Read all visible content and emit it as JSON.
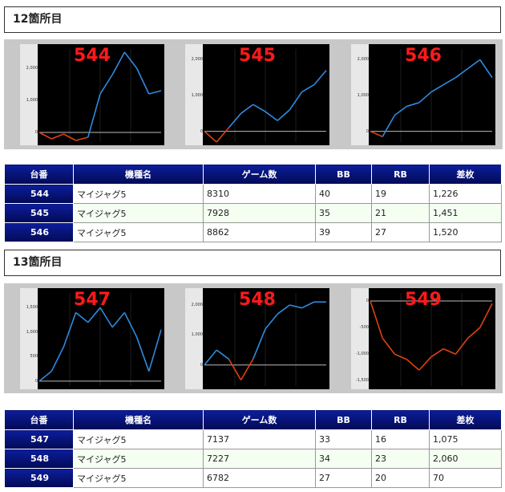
{
  "sections": [
    {
      "title": "12箇所目",
      "charts": [
        {
          "number": "544",
          "ticks": [
            "2,000",
            "1,000",
            "0"
          ]
        },
        {
          "number": "545",
          "ticks": [
            "2,000",
            "1,000",
            "0"
          ]
        },
        {
          "number": "546",
          "ticks": [
            "2,000",
            "1,000",
            "0"
          ]
        }
      ],
      "table": {
        "headers": [
          "台番",
          "機種名",
          "ゲーム数",
          "BB",
          "RB",
          "差枚"
        ],
        "rows": [
          [
            "544",
            "マイジャグ5",
            "8310",
            "40",
            "19",
            "1,226"
          ],
          [
            "545",
            "マイジャグ5",
            "7928",
            "35",
            "21",
            "1,451"
          ],
          [
            "546",
            "マイジャグ5",
            "8862",
            "39",
            "27",
            "1,520"
          ]
        ]
      }
    },
    {
      "title": "13箇所目",
      "charts": [
        {
          "number": "547",
          "ticks": [
            "1,500",
            "1,000",
            "500",
            "0"
          ]
        },
        {
          "number": "548",
          "ticks": [
            "2,000",
            "1,000",
            "0"
          ]
        },
        {
          "number": "549",
          "ticks": [
            "0",
            "-500",
            "-1,000",
            "-1,500"
          ]
        }
      ],
      "table": {
        "headers": [
          "台番",
          "機種名",
          "ゲーム数",
          "BB",
          "RB",
          "差枚"
        ],
        "rows": [
          [
            "547",
            "マイジャグ5",
            "7137",
            "33",
            "16",
            "1,075"
          ],
          [
            "548",
            "マイジャグ5",
            "7227",
            "34",
            "23",
            "2,060"
          ],
          [
            "549",
            "マイジャグ5",
            "6782",
            "27",
            "20",
            "70"
          ]
        ]
      }
    }
  ],
  "chart_data": [
    {
      "type": "line",
      "ylim": [
        -300,
        2600
      ],
      "x": [
        0,
        10,
        20,
        30,
        40,
        50,
        60,
        70,
        80,
        90,
        100
      ],
      "values": [
        0,
        -200,
        -50,
        -250,
        -150,
        1200,
        1800,
        2500,
        2000,
        1200,
        1300
      ]
    },
    {
      "type": "line",
      "ylim": [
        -300,
        2300
      ],
      "x": [
        0,
        10,
        20,
        30,
        40,
        50,
        60,
        70,
        80,
        90,
        100
      ],
      "values": [
        0,
        -300,
        100,
        500,
        750,
        550,
        300,
        600,
        1100,
        1300,
        1700
      ]
    },
    {
      "type": "line",
      "ylim": [
        -300,
        2300
      ],
      "x": [
        0,
        10,
        20,
        30,
        40,
        50,
        60,
        70,
        80,
        90,
        100
      ],
      "values": [
        0,
        -150,
        450,
        700,
        800,
        1100,
        1300,
        1500,
        1750,
        2000,
        1500
      ]
    },
    {
      "type": "line",
      "ylim": [
        -100,
        1800
      ],
      "x": [
        0,
        10,
        20,
        30,
        40,
        50,
        60,
        70,
        80,
        90,
        100
      ],
      "values": [
        0,
        200,
        700,
        1400,
        1200,
        1500,
        1100,
        1400,
        900,
        200,
        1050
      ]
    },
    {
      "type": "line",
      "ylim": [
        -700,
        2400
      ],
      "x": [
        0,
        10,
        20,
        30,
        40,
        50,
        60,
        70,
        80,
        90,
        100
      ],
      "values": [
        0,
        500,
        200,
        -500,
        200,
        1200,
        1700,
        2000,
        1900,
        2100,
        2100
      ]
    },
    {
      "type": "line",
      "ylim": [
        -1600,
        150
      ],
      "x": [
        0,
        10,
        20,
        30,
        40,
        50,
        60,
        70,
        80,
        90,
        100
      ],
      "values": [
        0,
        -700,
        -1000,
        -1100,
        -1300,
        -1050,
        -900,
        -1000,
        -700,
        -500,
        -50
      ]
    }
  ],
  "colors": {
    "positive": "#2e8be0",
    "negative": "#e04010",
    "header_bg": "#0c1d9c"
  }
}
